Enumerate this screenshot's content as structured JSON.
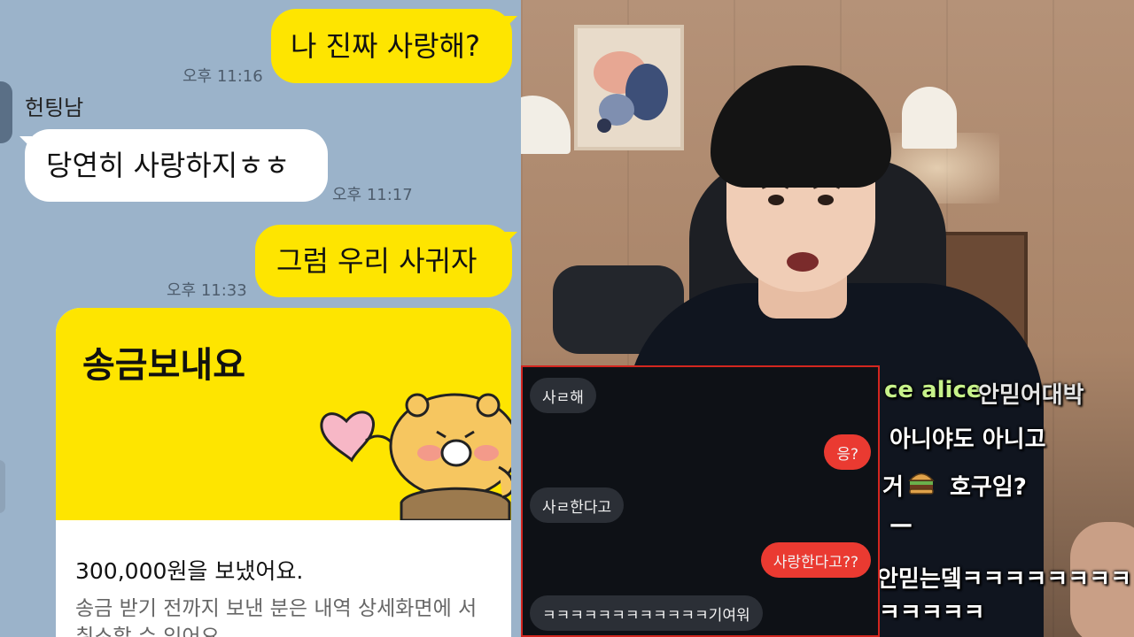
{
  "kakao_chat": {
    "messages": [
      {
        "side": "me",
        "text": "나 진짜 사랑해?",
        "time": "오후 11:16"
      },
      {
        "side": "other",
        "sender": "헌팅남",
        "text": "당연히 사랑하지ㅎㅎ",
        "time": "오후 11:17"
      },
      {
        "side": "me",
        "text": "그럼 우리 사귀자",
        "time": "오후 11:33"
      }
    ],
    "transfer_card": {
      "title": "송금보내요",
      "amount_text": "300,000원을 보냈어요.",
      "note": "송금 받기 전까지 보낸 분은 내역 상세화면에 서 취소할 수 있어요."
    },
    "colors": {
      "background": "#9bb3ca",
      "my_bubble": "#fee500",
      "other_bubble": "#ffffff"
    }
  },
  "stream_overlay": {
    "viewer_chat": [
      {
        "text": "ce alice",
        "color": "#c7f28a"
      },
      {
        "text": "안믿어대박",
        "color": "#e5e5e5"
      },
      {
        "text": "아니야도 아니고",
        "color": "#ffffff"
      },
      {
        "text": "거",
        "color": "#ffffff"
      },
      {
        "text": "호구임?",
        "color": "#ffffff"
      },
      {
        "text": "—",
        "color": "#ffffff"
      },
      {
        "text": "안믿는뎈ㅋㅋㅋㅋㅋㅋㅋㅋ",
        "color": "#ffffff"
      },
      {
        "text": "ㅋㅋㅋㅋㅋ",
        "color": "#ffffff"
      }
    ],
    "emoji_icon": "burger-icon"
  },
  "phone_chat": {
    "messages": [
      {
        "side": "in",
        "text": "사ㄹ해"
      },
      {
        "side": "out",
        "text": "응?"
      },
      {
        "side": "in",
        "text": "사ㄹ한다고"
      },
      {
        "side": "out",
        "text": "사랑한다고??"
      },
      {
        "side": "in",
        "text": "ㅋㅋㅋㅋㅋㅋㅋㅋㅋㅋㅋㅋ기여워"
      }
    ],
    "colors": {
      "background": "#0e1116",
      "incoming": "#2b2f36",
      "outgoing": "#ea3a31",
      "border": "#d3261f"
    }
  }
}
